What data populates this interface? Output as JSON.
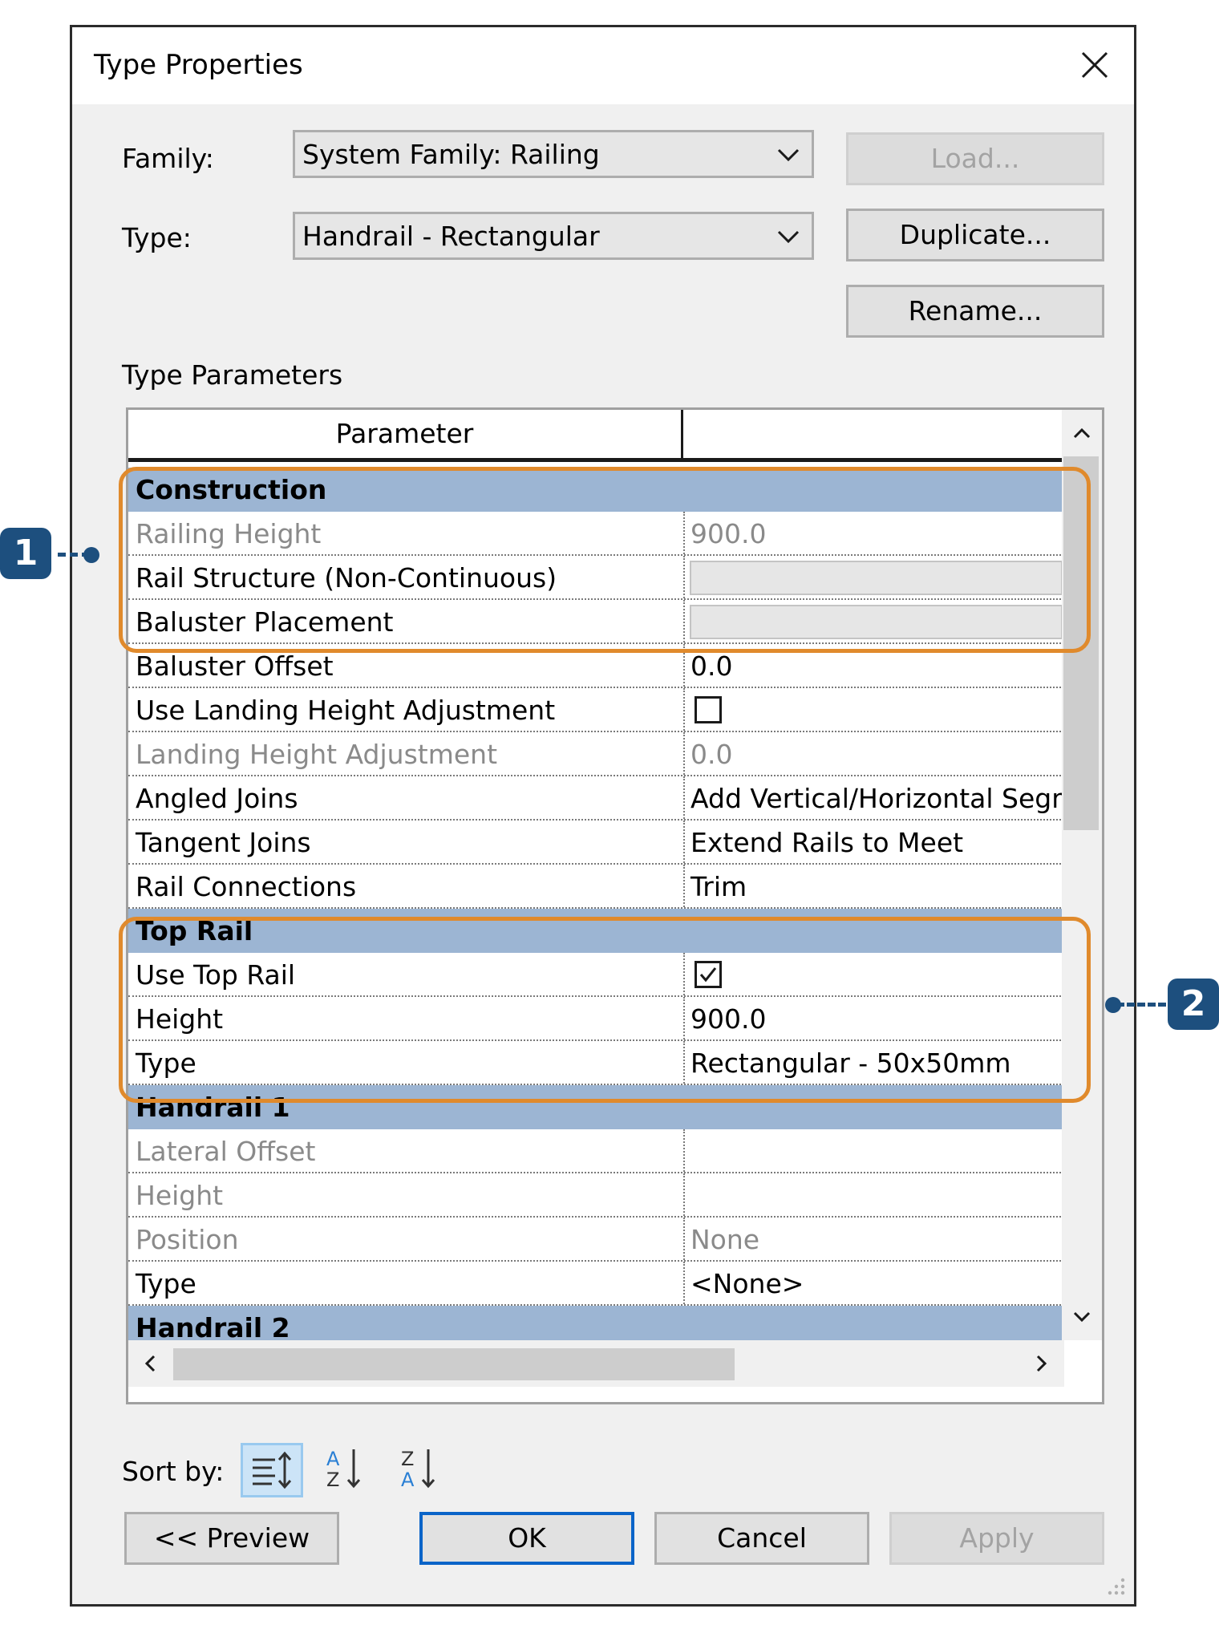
{
  "dialog": {
    "title": "Type Properties",
    "family_label": "Family:",
    "family_value": "System Family: Railing",
    "type_label": "Type:",
    "type_value": "Handrail - Rectangular",
    "load_label": "Load...",
    "duplicate_label": "Duplicate...",
    "rename_label": "Rename...",
    "type_parameters_label": "Type Parameters",
    "column_parameter": "Parameter",
    "column_value": ""
  },
  "rows": [
    {
      "kind": "group",
      "name": "Construction"
    },
    {
      "kind": "param",
      "name": "Railing Height",
      "value": "900.0",
      "dim": true
    },
    {
      "kind": "param",
      "name": "Rail Structure (Non-Continuous)",
      "value": "",
      "disabled_value": true
    },
    {
      "kind": "param",
      "name": "Baluster Placement",
      "value": "",
      "disabled_value": true
    },
    {
      "kind": "param",
      "name": "Baluster Offset",
      "value": "0.0"
    },
    {
      "kind": "param",
      "name": "Use Landing Height Adjustment",
      "checkbox": false
    },
    {
      "kind": "param",
      "name": "Landing Height Adjustment",
      "value": "0.0",
      "dim": true
    },
    {
      "kind": "param",
      "name": "Angled Joins",
      "value": "Add Vertical/Horizontal Segments"
    },
    {
      "kind": "param",
      "name": "Tangent Joins",
      "value": "Extend Rails to Meet"
    },
    {
      "kind": "param",
      "name": "Rail Connections",
      "value": "Trim"
    },
    {
      "kind": "group",
      "name": "Top Rail"
    },
    {
      "kind": "param",
      "name": "Use Top Rail",
      "checkbox": true
    },
    {
      "kind": "param",
      "name": "Height",
      "value": "900.0"
    },
    {
      "kind": "param",
      "name": "Type",
      "value": "Rectangular - 50x50mm"
    },
    {
      "kind": "group",
      "name": "Handrail 1"
    },
    {
      "kind": "param",
      "name": "Lateral Offset",
      "value": "",
      "dim": true
    },
    {
      "kind": "param",
      "name": "Height",
      "value": "",
      "dim": true
    },
    {
      "kind": "param",
      "name": "Position",
      "value": "None",
      "dim": true
    },
    {
      "kind": "param",
      "name": "Type",
      "value": "<None>"
    },
    {
      "kind": "group",
      "name": "Handrail 2"
    }
  ],
  "footer": {
    "sort_by_label": "Sort by:",
    "preview_label": "<< Preview",
    "ok_label": "OK",
    "cancel_label": "Cancel",
    "apply_label": "Apply"
  },
  "callouts": {
    "one": "1",
    "two": "2"
  },
  "colors": {
    "group_header": "#9cb5d3",
    "highlight": "#e08a2c",
    "callout": "#1d4f7e",
    "default_button_border": "#0a64c8"
  }
}
